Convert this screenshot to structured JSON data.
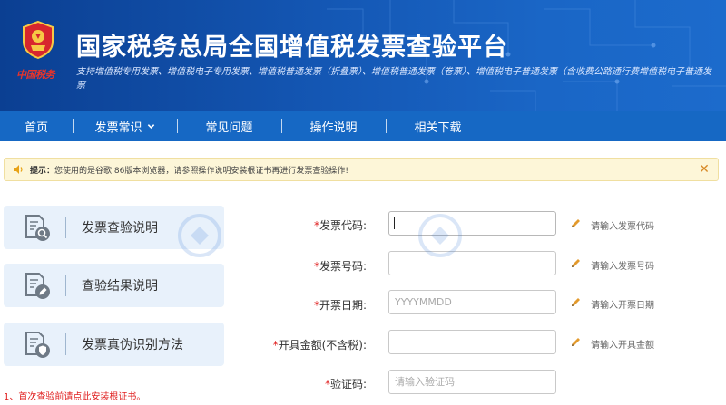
{
  "header": {
    "title": "国家税务总局全国增值税发票查验平台",
    "subtitle": "支持增值税专用发票、增值税电子专用发票、增值税普通发票（折叠票）、增值税普通发票（卷票）、增值税电子普通发票（含收费公路通行费增值税电子普通发票",
    "brand": "中国税务"
  },
  "nav": {
    "items": [
      {
        "label": "首页"
      },
      {
        "label": "发票常识"
      },
      {
        "label": "常见问题"
      },
      {
        "label": "操作说明"
      },
      {
        "label": "相关下载"
      }
    ]
  },
  "notice": {
    "label": "提示：",
    "text": "您使用的是谷歌 86版本浏览器，请参照操作说明安装根证书再进行发票查验操作!"
  },
  "help_cards": [
    {
      "label": "发票查验说明",
      "icon": "search-document-icon"
    },
    {
      "label": "查验结果说明",
      "icon": "edit-document-icon"
    },
    {
      "label": "发票真伪识别方法",
      "icon": "shield-document-icon"
    }
  ],
  "install_link": "1、首次查验前请点此安装根证书。",
  "form": {
    "invoice_code": {
      "label": "发票代码:",
      "value": "",
      "placeholder": "",
      "hint": "请输入发票代码"
    },
    "invoice_number": {
      "label": "发票号码:",
      "value": "",
      "placeholder": "",
      "hint": "请输入发票号码"
    },
    "issue_date": {
      "label": "开票日期:",
      "value": "",
      "placeholder": "YYYYMMDD",
      "hint": "请输入开票日期"
    },
    "amount": {
      "label": "开具金额(不含税):",
      "value": "",
      "placeholder": "",
      "hint": "请输入开具金额"
    },
    "captcha": {
      "label": "验证码:",
      "value": "",
      "placeholder": "请输入验证码"
    },
    "required_mark": "*"
  },
  "colors": {
    "banner": "#1457b4",
    "nav": "#1668c4",
    "card": "#e8f1fb",
    "required": "#e02020",
    "notice_bg": "#fdf6d8"
  }
}
